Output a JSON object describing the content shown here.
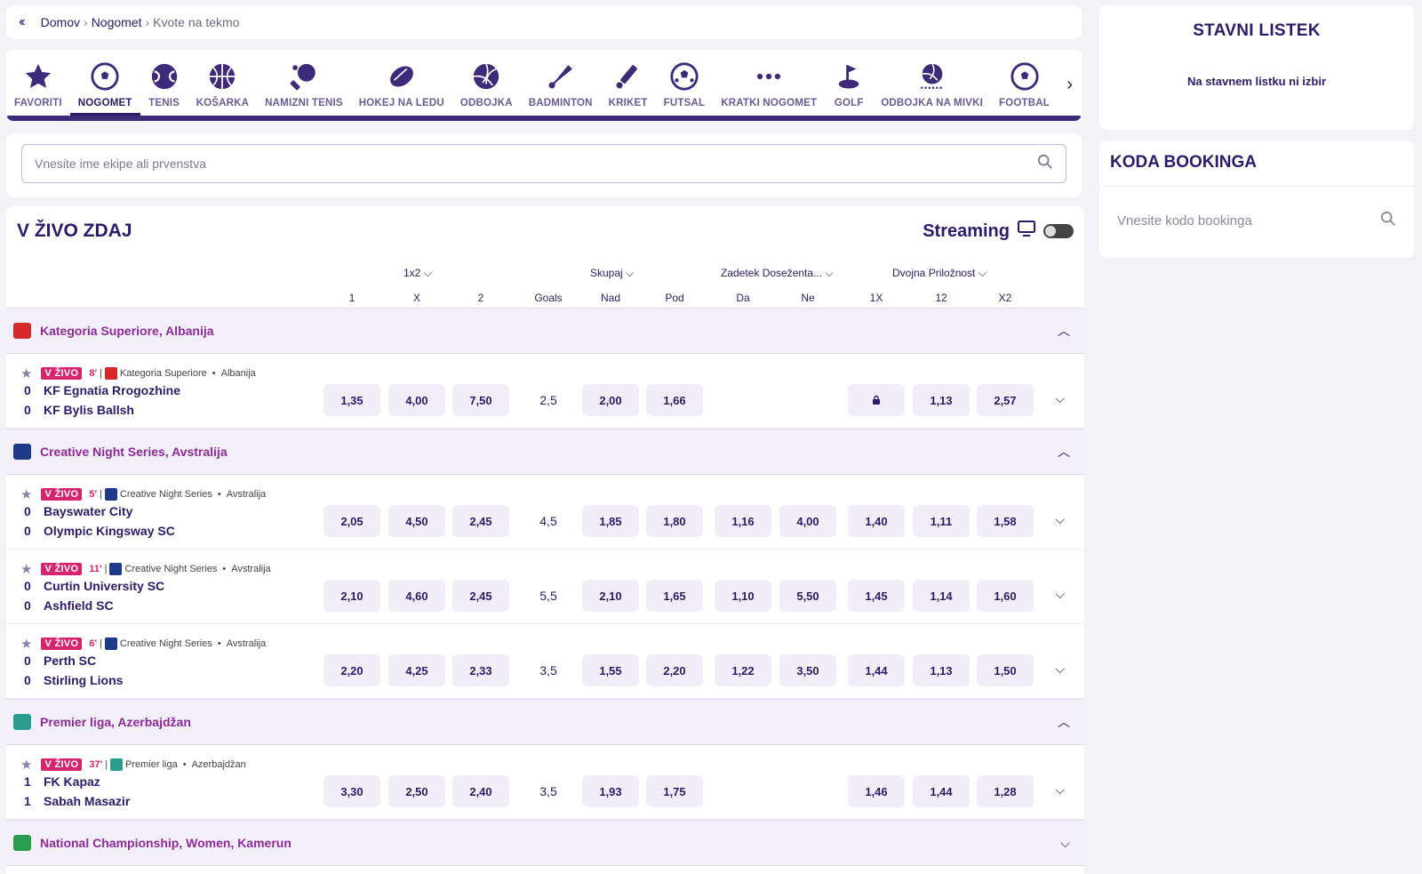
{
  "breadcrumb": {
    "back_icon": "double-chevron-left-icon",
    "items": [
      "Domov",
      "Nogomet",
      "Kvote na tekmo"
    ]
  },
  "sports": [
    {
      "label": "FAVORITI",
      "icon": "star-icon"
    },
    {
      "label": "NOGOMET",
      "icon": "soccer-ball-icon",
      "active": true
    },
    {
      "label": "TENIS",
      "icon": "tennis-ball-icon"
    },
    {
      "label": "KOŠARKA",
      "icon": "basketball-icon"
    },
    {
      "label": "NAMIZNI TENIS",
      "icon": "table-tennis-icon"
    },
    {
      "label": "HOKEJ NA LEDU",
      "icon": "hockey-puck-icon"
    },
    {
      "label": "ODBOJKA",
      "icon": "volleyball-icon"
    },
    {
      "label": "BADMINTON",
      "icon": "shuttlecock-icon"
    },
    {
      "label": "KRIKET",
      "icon": "cricket-icon"
    },
    {
      "label": "FUTSAL",
      "icon": "futsal-ball-icon"
    },
    {
      "label": "KRATKI NOGOMET",
      "icon": "more-dots-icon"
    },
    {
      "label": "GOLF",
      "icon": "golf-icon"
    },
    {
      "label": "ODBOJKA NA MIVKI",
      "icon": "beach-volleyball-icon"
    },
    {
      "label": "FOOTBAL",
      "icon": "football-icon"
    }
  ],
  "search": {
    "placeholder": "Vnesite ime ekipe ali prvenstva",
    "icon": "search-icon"
  },
  "live": {
    "title": "V ŽIVO ZDAJ",
    "streaming_label": "Streaming",
    "markets": [
      {
        "name": "1x2"
      },
      {
        "name": "Skupaj"
      },
      {
        "name": "Zadetek Doseženta..."
      },
      {
        "name": "Dvojna Priložnost"
      }
    ],
    "columns": [
      "1",
      "X",
      "2",
      "Goals",
      "Nad",
      "Pod",
      "Da",
      "Ne",
      "1X",
      "12",
      "X2"
    ],
    "leagues": [
      {
        "name": "Kategoria Superiore, Albanija",
        "flag_color": "#d62828",
        "matches": [
          {
            "badge": "V ŽIVO",
            "minute": "8'",
            "competition": "Kategoria Superiore",
            "country": "Albanija",
            "home": "KF Egnatia Rrogozhine",
            "away": "KF Bylis Ballsh",
            "score_home": "0",
            "score_away": "0",
            "odds": [
              "1,35",
              "4,00",
              "7,50",
              "2,5",
              "2,00",
              "1,66",
              "",
              "",
              "🔒",
              "1,13",
              "2,57"
            ]
          }
        ]
      },
      {
        "name": "Creative Night Series, Avstralija",
        "flag_color": "#1e3a8a",
        "matches": [
          {
            "badge": "V ŽIVO",
            "minute": "5'",
            "competition": "Creative Night Series",
            "country": "Avstralija",
            "home": "Bayswater City",
            "away": "Olympic Kingsway SC",
            "score_home": "0",
            "score_away": "0",
            "odds": [
              "2,05",
              "4,50",
              "2,45",
              "4,5",
              "1,85",
              "1,80",
              "1,16",
              "4,00",
              "1,40",
              "1,11",
              "1,58"
            ]
          },
          {
            "badge": "V ŽIVO",
            "minute": "11'",
            "competition": "Creative Night Series",
            "country": "Avstralija",
            "home": "Curtin University SC",
            "away": "Ashfield SC",
            "score_home": "0",
            "score_away": "0",
            "odds": [
              "2,10",
              "4,60",
              "2,45",
              "5,5",
              "2,10",
              "1,65",
              "1,10",
              "5,50",
              "1,45",
              "1,14",
              "1,60"
            ]
          },
          {
            "badge": "V ŽIVO",
            "minute": "6'",
            "competition": "Creative Night Series",
            "country": "Avstralija",
            "home": "Perth SC",
            "away": "Stirling Lions",
            "score_home": "0",
            "score_away": "0",
            "odds": [
              "2,20",
              "4,25",
              "2,33",
              "3,5",
              "1,55",
              "2,20",
              "1,22",
              "3,50",
              "1,44",
              "1,13",
              "1,50"
            ]
          }
        ]
      },
      {
        "name": "Premier liga, Azerbajdžan",
        "flag_color": "#2a9d8f",
        "matches": [
          {
            "badge": "V ŽIVO",
            "minute": "37'",
            "competition": "Premier liga",
            "country": "Azerbajdžan",
            "home": "FK Kapaz",
            "away": "Sabah Masazir",
            "score_home": "1",
            "score_away": "1",
            "odds": [
              "3,30",
              "2,50",
              "2,40",
              "3,5",
              "1,93",
              "1,75",
              "",
              "",
              "1,46",
              "1,44",
              "1,28"
            ]
          }
        ]
      },
      {
        "name": "National Championship, Women, Kamerun",
        "flag_color": "#2a9d4f",
        "collapsed": true,
        "matches": []
      }
    ]
  },
  "betslip": {
    "title": "STAVNI LISTEK",
    "empty_text": "Na stavnem listku ni izbir"
  },
  "booking": {
    "title": "KODA BOOKINGA",
    "placeholder": "Vnesite kodo bookinga"
  },
  "colors": {
    "primary": "#2d1b69",
    "league_text": "#8e2a9c",
    "live_badge": "#d6246e",
    "odd_bg": "#f2eef9"
  }
}
